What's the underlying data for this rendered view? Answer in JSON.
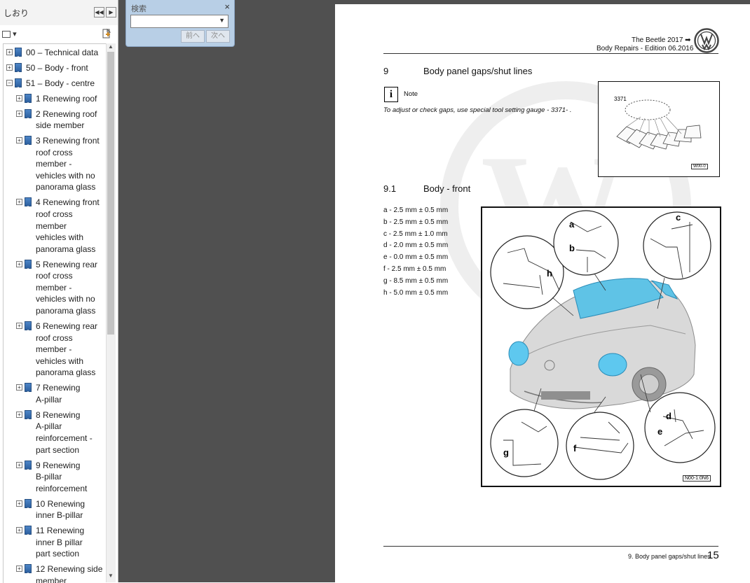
{
  "bookmarks_panel": {
    "title": "しおり",
    "collapse_label": "◀◀",
    "expand_label": "▶",
    "options_label": "▾",
    "items": [
      {
        "lines": [
          "00 – Technical data"
        ]
      },
      {
        "lines": [
          "50 – Body - front"
        ]
      },
      {
        "lines": [
          "51 – Body - centre"
        ]
      },
      {
        "lines": [
          "1 Renewing roof"
        ]
      },
      {
        "lines": [
          "2 Renewing roof",
          "side member"
        ]
      },
      {
        "lines": [
          "3 Renewing front",
          "roof cross",
          "member -",
          "vehicles with no",
          "panorama glass"
        ]
      },
      {
        "lines": [
          "4 Renewing front",
          "roof cross",
          "member",
          "vehicles with",
          "panorama glass"
        ]
      },
      {
        "lines": [
          "5 Renewing rear",
          "roof cross",
          "member -",
          "vehicles with no",
          "panorama glass"
        ]
      },
      {
        "lines": [
          "6 Renewing rear",
          "roof cross",
          "member -",
          "vehicles with",
          "panorama glass"
        ]
      },
      {
        "lines": [
          "7 Renewing",
          "A-pillar"
        ]
      },
      {
        "lines": [
          "8 Renewing",
          "A-pillar",
          "reinforcement -",
          "part section"
        ]
      },
      {
        "lines": [
          "9 Renewing",
          "B-pillar",
          "reinforcement"
        ]
      },
      {
        "lines": [
          "10 Renewing",
          "inner B-pillar"
        ]
      },
      {
        "lines": [
          "11 Renewing",
          "inner B pillar",
          "part section"
        ]
      },
      {
        "lines": [
          "12 Renewing side",
          "member"
        ]
      }
    ]
  },
  "search": {
    "title": "検索",
    "close": "×",
    "prev": "前へ",
    "next": "次へ"
  },
  "page": {
    "header_model": "The Beetle 2017 ➡",
    "header_edition": "Body Repairs - Edition 06.2016",
    "section_number": "9",
    "section_title": "Body panel gaps/shut lines",
    "note_label": "Note",
    "note_text": "To adjust or check gaps, use special tool setting gauge - 3371- .",
    "tool_label": "3371",
    "tool_fig_id": "W00-0",
    "subsection_number": "9.1",
    "subsection_title": "Body - front",
    "gaps": [
      "a - 2.5 mm ± 0.5 mm",
      "b - 2.5 mm ± 0.5 mm",
      "c - 2.5 mm ± 1.0 mm",
      "d - 2.0 mm ± 0.5 mm",
      "e - 0.0 mm ± 0.5 mm",
      "f - 2.5 mm ± 0.5 mm",
      "g - 8.5 mm ± 0.5 mm",
      "h - 5.0 mm ± 0.5 mm"
    ],
    "car_fig_id": "N00-1:0N6",
    "callouts": [
      "a",
      "b",
      "c",
      "d",
      "e",
      "f",
      "g",
      "h"
    ],
    "footer_text": "9. Body panel gaps/shut lines",
    "page_number": "15"
  },
  "colors": {
    "doc_background": "#505050",
    "highlight_cyan": "#2aa6d6",
    "search_panel": "#b8cfe6"
  }
}
